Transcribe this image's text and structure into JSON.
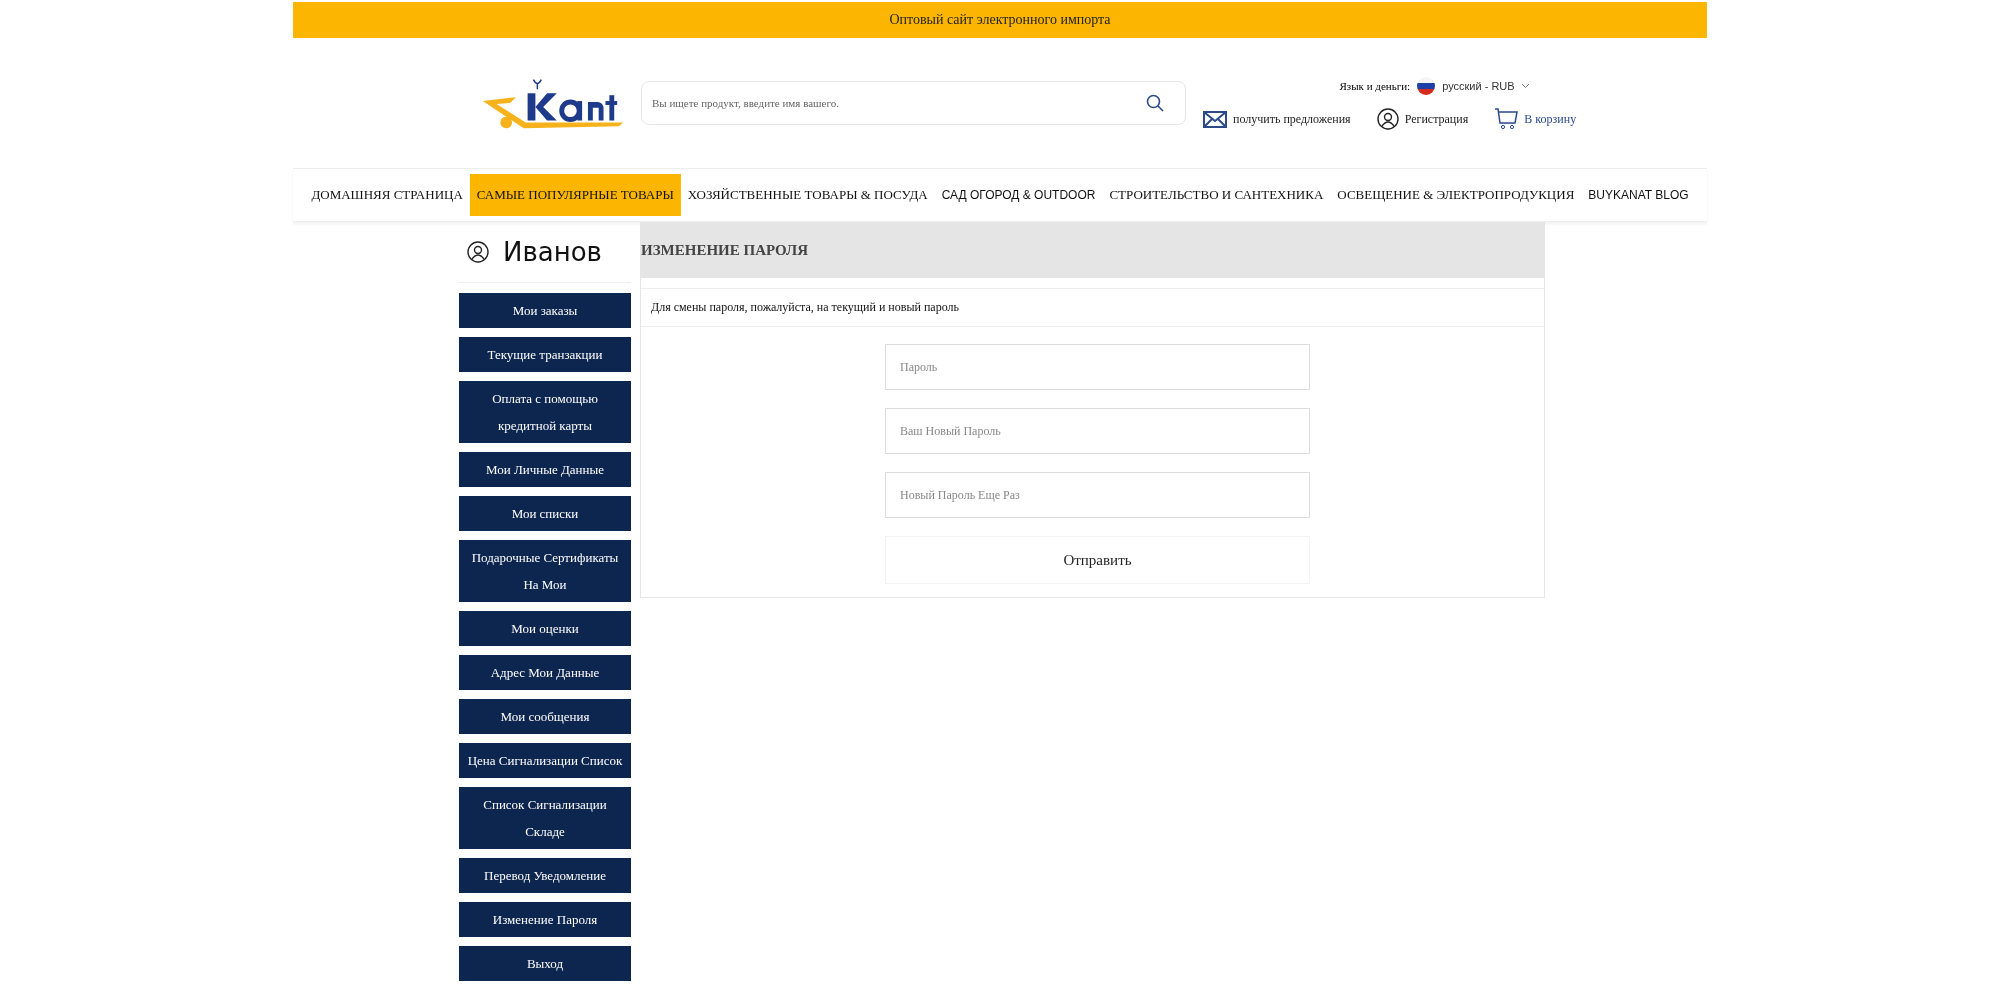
{
  "top_banner": "Оптовый сайт электронного импорта",
  "header": {
    "search": {
      "placeholder": "Вы ищете продукт, введите имя вашего."
    },
    "language_label": "Язык и деньги:",
    "language_value": "русский - RUB",
    "links": [
      {
        "kind": "offers",
        "label": "получить предложения"
      },
      {
        "kind": "account",
        "label": "Регистрация"
      },
      {
        "kind": "cart",
        "label": "В корзину"
      }
    ]
  },
  "nav": [
    {
      "label": "ДОМАШНЯЯ СТРАНИЦА",
      "selected": false
    },
    {
      "label": "САМЫЕ ПОПУЛЯРНЫЕ ТОВАРЫ",
      "selected": true
    },
    {
      "label": "ХОЗЯЙСТВЕННЫЕ ТОВАРЫ & ПОСУДА",
      "selected": false
    },
    {
      "label": "САД ОГОРОД & OUTDOOR",
      "selected": false
    },
    {
      "label": "СТРОИТЕЛЬСТВО И САНТЕХНИКА",
      "selected": false
    },
    {
      "label": "ОСВЕЩЕНИЕ & ЭЛЕКТРОПРОДУКЦИЯ",
      "selected": false
    },
    {
      "label": "BUYKANAT BLOG",
      "selected": false
    }
  ],
  "sidebar": {
    "user_name": "Иванов",
    "items": [
      "Мои заказы",
      "Текущие транзакции",
      "Оплата с помощью кредитной карты",
      "Мои Личные Данные",
      "Мои списки",
      "Подарочные Сертификаты На Мои",
      "Мои оценки",
      "Адрес Мои Данные",
      "Мои сообщения",
      "Цена Сигнализации Список",
      "Список Сигнализации Складе",
      "Перевод Уведомление",
      "Изменение Пароля",
      "Выход"
    ]
  },
  "panel": {
    "title": "ИЗМЕНЕНИЕ ПАРОЛЯ",
    "description": "Для смены пароля, пожалуйста, на текущий и новый пароль",
    "fields": [
      {
        "placeholder": "Пароль"
      },
      {
        "placeholder": "Ваш Новый Пароль"
      },
      {
        "placeholder": "Новый Пароль Еще Раз"
      }
    ],
    "submit": "Отправить"
  }
}
